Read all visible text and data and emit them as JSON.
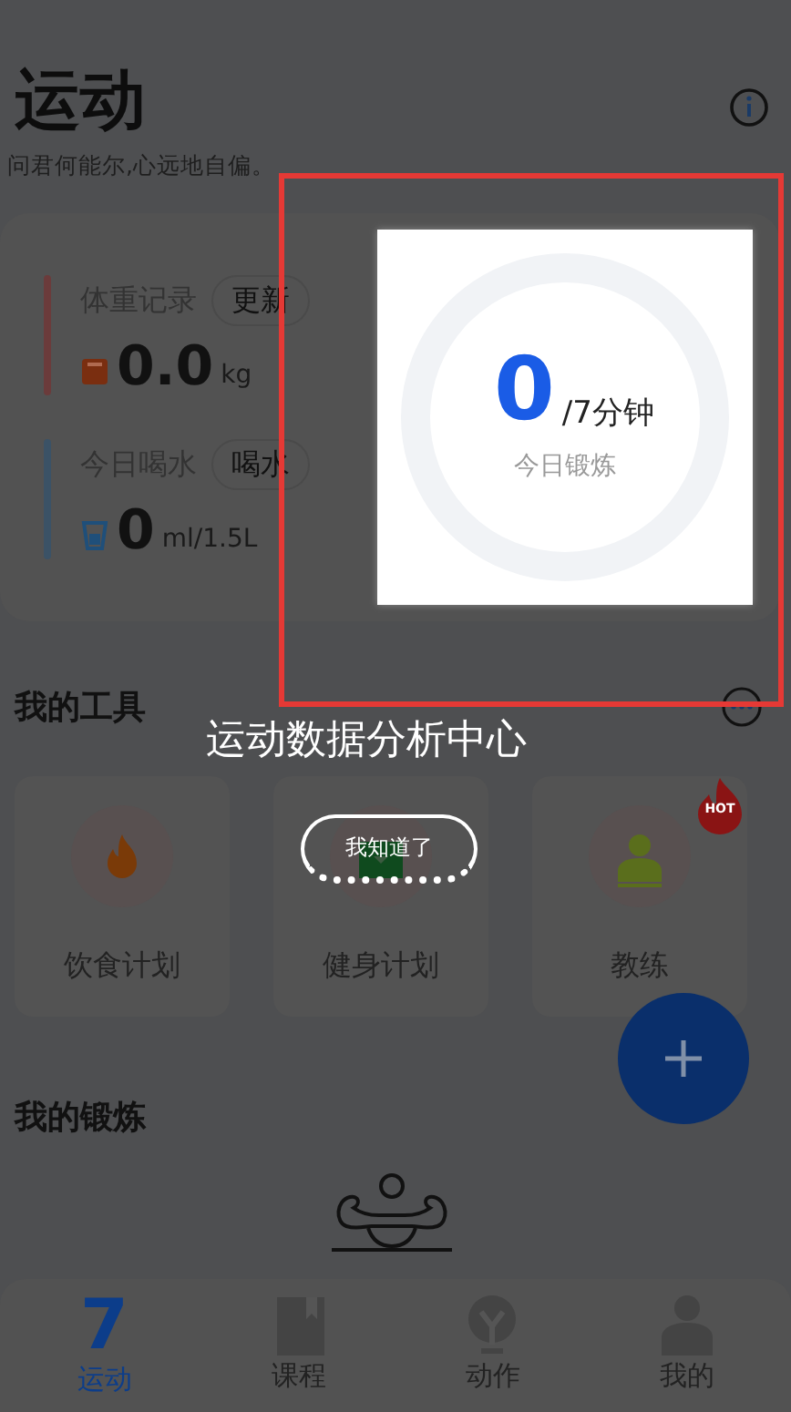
{
  "header": {
    "title": "运动",
    "subtitle": "问君何能尔,心远地自偏。"
  },
  "records": [
    {
      "kind": "weight",
      "label": "体重记录",
      "action": "更新",
      "value": "0.0",
      "unit": "kg",
      "color": "#6b3b3b"
    },
    {
      "kind": "water",
      "label": "今日喝水",
      "action": "喝水",
      "value": "0",
      "unit": "ml/1.5L",
      "color": "#3b5266"
    }
  ],
  "exercise_ring": {
    "value": "0",
    "target": "/7分钟",
    "label": "今日锻炼"
  },
  "guide": {
    "caption": "运动数据分析中心",
    "dismiss": "我知道了"
  },
  "tools": {
    "title": "我的工具",
    "items": [
      {
        "kind": "diet",
        "label": "饮食计划"
      },
      {
        "kind": "fitness",
        "label": "健身计划"
      },
      {
        "kind": "coach",
        "label": "教练",
        "badge": "HOT"
      }
    ]
  },
  "workouts": {
    "title": "我的锻炼"
  },
  "tabs": [
    {
      "kind": "calendar",
      "icon_text": "7",
      "label": "运动",
      "selected": true
    },
    {
      "kind": "book",
      "label": "课程",
      "selected": false
    },
    {
      "kind": "bulb",
      "label": "动作",
      "selected": false
    },
    {
      "kind": "person",
      "label": "我的",
      "selected": false
    }
  ]
}
